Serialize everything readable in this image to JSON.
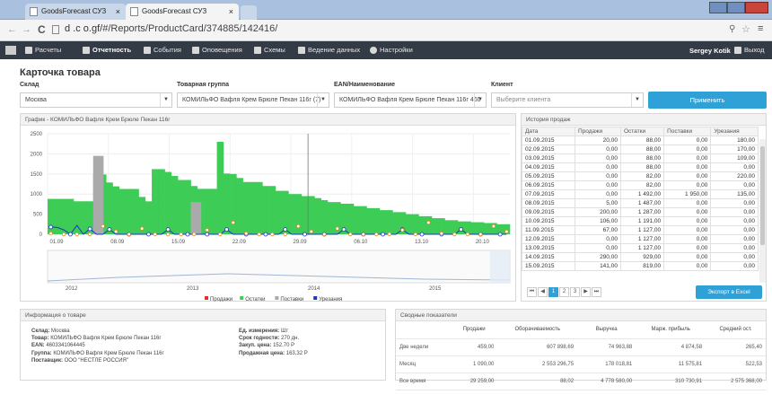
{
  "browser": {
    "tabs": [
      {
        "title": "GoodsForecast СУЗ",
        "close": "×"
      },
      {
        "title": "GoodsForecast СУЗ",
        "close": "×"
      }
    ],
    "url_prefix": "d  .c  o.gf/",
    "url_path": "#/Reports/ProductCard/374885/142416/"
  },
  "nav": {
    "items": [
      "Расчеты",
      "Отчетность",
      "События",
      "Оповещения",
      "Схемы",
      "Ведение данных",
      "Настройки"
    ],
    "user": "Sergey Kotik",
    "logout": "Выход"
  },
  "page": {
    "title": "Карточка товара"
  },
  "filters": {
    "warehouse_label": "Склад",
    "warehouse_value": "Москва",
    "group_label": "Товарная группа",
    "group_value": "КОМИЛЬФО Вафля Крем Брюле Пекан 116г (7)",
    "ean_label": "EAN/Наименование",
    "ean_value": "КОМИЛЬФО Вафля Крем Брюле Пекан 116г 460",
    "client_label": "Клиент",
    "client_placeholder": "Выберите клиента",
    "apply": "Применить"
  },
  "chart_panel": {
    "title": "График - КОМИЛЬФО Вафля Крем Брюле Пекан 116г"
  },
  "chart_data": {
    "type": "bar",
    "title": "График - КОМИЛЬФО Вафля Крем Брюле Пекан 116г",
    "ylim": [
      0,
      2500
    ],
    "yticks": [
      "2500",
      "2000",
      "1500",
      "1000",
      "500",
      "0"
    ],
    "xticks": [
      "01.09",
      "08.09",
      "15.09",
      "22.09",
      "29.09",
      "06.10",
      "13.10",
      "20.10"
    ],
    "navigator_years": [
      "2012",
      "2013",
      "2014",
      "2015"
    ],
    "series": [
      {
        "name": "Продажи",
        "color": "#e0302a"
      },
      {
        "name": "Остатки",
        "color": "#3dcc55",
        "values": [
          880,
          880,
          880,
          880,
          820,
          820,
          820,
          1492,
          1487,
          1287,
          1191,
          1127,
          1127,
          1127,
          929,
          819,
          1620,
          1620,
          1550,
          1450,
          1350,
          1350,
          1200,
          1130,
          1130,
          1130,
          2300,
          1510,
          1500,
          1400,
          1300,
          1300,
          1300,
          1200,
          1200,
          1080,
          1080,
          1000,
          1000,
          950,
          950,
          900,
          850,
          800,
          800,
          760,
          760,
          700,
          700,
          650,
          650,
          600,
          600,
          550,
          550,
          500,
          500,
          450,
          450,
          400,
          400,
          350,
          350,
          320,
          320,
          300,
          300,
          280,
          280,
          250,
          250
        ]
      },
      {
        "name": "Поставки",
        "color": "#aaaaaa",
        "peaks": [
          {
            "i": 7,
            "v": 1950
          },
          {
            "i": 22,
            "v": 800
          }
        ]
      },
      {
        "name": "Урезания",
        "color": "#2233cc"
      }
    ]
  },
  "history": {
    "title": "История продаж",
    "columns": [
      "Дата",
      "Продажи",
      "Остатки",
      "Поставки",
      "Урезания"
    ],
    "rows": [
      [
        "01.09.2015",
        "20,00",
        "88,00",
        "0,00",
        "180,00"
      ],
      [
        "02.09.2015",
        "0,00",
        "88,00",
        "0,00",
        "170,00"
      ],
      [
        "03.09.2015",
        "0,00",
        "88,00",
        "0,00",
        "109,00"
      ],
      [
        "04.09.2015",
        "0,00",
        "88,00",
        "0,00",
        "0,00"
      ],
      [
        "05.09.2015",
        "0,00",
        "82,00",
        "0,00",
        "220,00"
      ],
      [
        "06.09.2015",
        "0,00",
        "82,00",
        "0,00",
        "0,00"
      ],
      [
        "07.09.2015",
        "0,00",
        "1 492,00",
        "1 950,00",
        "135,00"
      ],
      [
        "08.09.2015",
        "5,00",
        "1 487,00",
        "0,00",
        "0,00"
      ],
      [
        "09.09.2015",
        "200,00",
        "1 287,00",
        "0,00",
        "0,00"
      ],
      [
        "10.09.2015",
        "106,00",
        "1 191,00",
        "0,00",
        "0,00"
      ],
      [
        "11.09.2015",
        "67,00",
        "1 127,00",
        "0,00",
        "0,00"
      ],
      [
        "12.09.2015",
        "0,00",
        "1 127,00",
        "0,00",
        "0,00"
      ],
      [
        "13.09.2015",
        "0,00",
        "1 127,00",
        "0,00",
        "0,00"
      ],
      [
        "14.09.2015",
        "290,00",
        "929,00",
        "0,00",
        "0,00"
      ],
      [
        "15.09.2015",
        "141,00",
        "819,00",
        "0,00",
        "0,00"
      ]
    ],
    "pages": [
      "1",
      "2",
      "3"
    ],
    "export": "Экспорт в Excel"
  },
  "info": {
    "title": "Информация о товаре",
    "left": [
      [
        "Склад:",
        "Москва"
      ],
      [
        "Товар:",
        "КОМИЛЬФО Вафля Крем Брюле Пекан 116г"
      ],
      [
        "EAN:",
        "4603341064445"
      ],
      [
        "Группа:",
        "КОМИЛЬФО Вафля Крем Брюле Пекан 116г"
      ],
      [
        "Поставщик:",
        "ООО \"НЕСТЛЕ РОССИЯ\""
      ]
    ],
    "right": [
      [
        "Ед. измерения:",
        "Шт"
      ],
      [
        "Срок годности:",
        "270 дн."
      ],
      [
        "Закуп. цена:",
        "152,70 Р"
      ],
      [
        "Продажная цена:",
        "163,32 Р"
      ]
    ]
  },
  "summary": {
    "title": "Сводные показатели",
    "columns": [
      "",
      "Продажи",
      "Оборачиваемость",
      "Выручка",
      "Марж. прибыль",
      "Средний ост."
    ],
    "rows": [
      [
        "Две недели",
        "459,00",
        "607 898,69",
        "74 963,88",
        "4 874,58",
        "265,40"
      ],
      [
        "Месяц",
        "1 090,00",
        "2 553 296,75",
        "178 018,81",
        "11 575,81",
        "522,53"
      ],
      [
        "Все время",
        "29 259,00",
        "88,02",
        "4 778 580,00",
        "310 730,91",
        "2 575 368,00"
      ]
    ]
  }
}
